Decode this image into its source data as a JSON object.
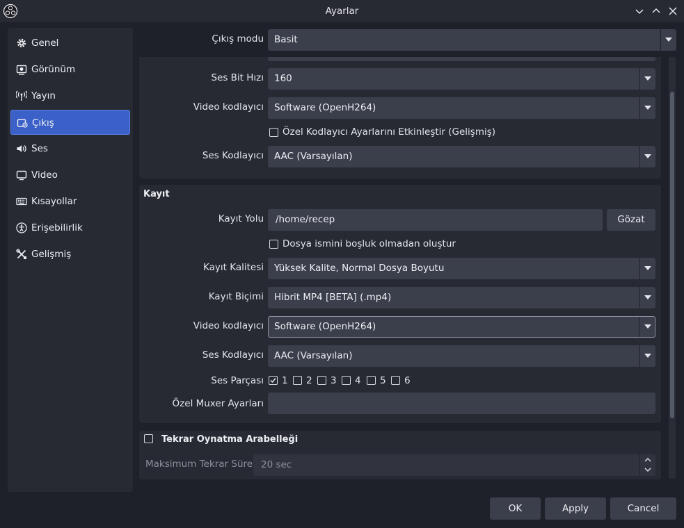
{
  "window": {
    "title": "Ayarlar"
  },
  "sidebar": {
    "items": [
      {
        "label": "Genel",
        "icon": "gear-icon"
      },
      {
        "label": "Görünüm",
        "icon": "appearance-icon"
      },
      {
        "label": "Yayın",
        "icon": "broadcast-icon"
      },
      {
        "label": "Çıkış",
        "icon": "output-icon",
        "active": true
      },
      {
        "label": "Ses",
        "icon": "speaker-icon"
      },
      {
        "label": "Video",
        "icon": "monitor-icon"
      },
      {
        "label": "Kısayollar",
        "icon": "keyboard-icon"
      },
      {
        "label": "Erişebilirlik",
        "icon": "accessibility-icon"
      },
      {
        "label": "Gelişmiş",
        "icon": "tools-icon"
      }
    ]
  },
  "output_mode": {
    "label": "Çıkış modu",
    "value": "Basit"
  },
  "streaming": {
    "audio_bitrate": {
      "label": "Ses Bit Hızı",
      "value": "160"
    },
    "video_encoder": {
      "label": "Video kodlayıcı",
      "value": "Software (OpenH264)"
    },
    "custom_encoder_checkbox": "Özel Kodlayıcı Ayarlarını Etkinleştir (Gelişmiş)",
    "audio_encoder": {
      "label": "Ses Kodlayıcı",
      "value": "AAC (Varsayılan)"
    }
  },
  "recording": {
    "title": "Kayıt",
    "path": {
      "label": "Kayıt Yolu",
      "value": "/home/recep",
      "browse": "Gözat"
    },
    "no_space_checkbox": "Dosya ismini boşluk olmadan oluştur",
    "quality": {
      "label": "Kayıt Kalitesi",
      "value": "Yüksek Kalite, Normal Dosya Boyutu"
    },
    "format": {
      "label": "Kayıt Biçimi",
      "value": "Hibrit MP4 [BETA] (.mp4)"
    },
    "video_encoder": {
      "label": "Video kodlayıcı",
      "value": "Software (OpenH264)"
    },
    "audio_encoder": {
      "label": "Ses Kodlayıcı",
      "value": "AAC (Varsayılan)"
    },
    "audio_tracks": {
      "label": "Ses Parçası",
      "tracks": [
        "1",
        "2",
        "3",
        "4",
        "5",
        "6"
      ],
      "checked": [
        true,
        false,
        false,
        false,
        false,
        false
      ]
    },
    "muxer": {
      "label": "Özel Muxer Ayarları",
      "value": ""
    }
  },
  "replay_buffer": {
    "title": "Tekrar Oynatma Arabelleği",
    "max_time": {
      "label": "Maksimum Tekrar Süresi",
      "value": "20 sec"
    }
  },
  "footer": {
    "ok": "OK",
    "apply": "Apply",
    "cancel": "Cancel"
  }
}
